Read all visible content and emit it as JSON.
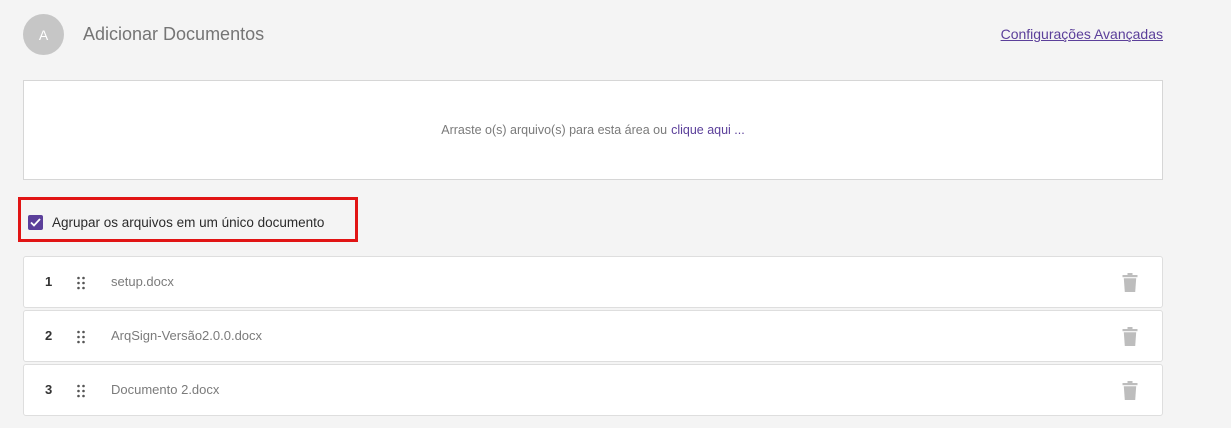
{
  "header": {
    "avatar_letter": "A",
    "title": "Adicionar Documentos",
    "advanced_link": "Configurações Avançadas"
  },
  "dropzone": {
    "text": "Arraste o(s) arquivo(s) para esta área ou",
    "link": "clique aqui ..."
  },
  "group_option": {
    "checked": true,
    "label": "Agrupar os arquivos em um único documento"
  },
  "files": [
    {
      "index": "1",
      "name": "setup.docx"
    },
    {
      "index": "2",
      "name": "ArqSign-Versão2.0.0.docx"
    },
    {
      "index": "3",
      "name": "Documento 2.docx"
    }
  ],
  "icons": {
    "drag_handle": "drag-handle-icon",
    "delete": "trash-icon",
    "check": "check-icon"
  },
  "colors": {
    "accent": "#5b3f9a",
    "highlight_border": "#e11414",
    "trash": "#bdbdbd"
  }
}
